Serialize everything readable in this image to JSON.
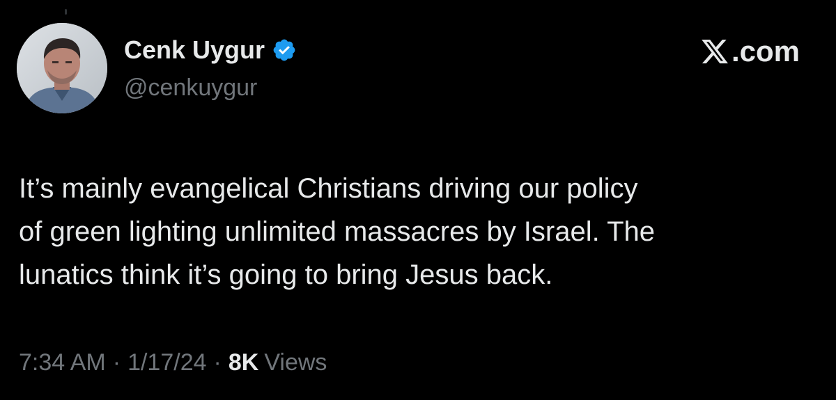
{
  "author": {
    "display_name": "Cenk Uygur",
    "handle": "@cenkuygur",
    "verified": true,
    "verified_icon": "verified-badge-icon",
    "verified_color": "#1d9bf0"
  },
  "brand": {
    "logo_icon": "x-logo-icon",
    "text": ".com"
  },
  "tweet": {
    "lines": [
      "It’s mainly evangelical Christians driving our policy",
      "of green lighting unlimited massacres by Israel. The",
      "lunatics think it’s going to bring Jesus back."
    ]
  },
  "meta": {
    "time": "7:34 AM",
    "separator": "·",
    "date": "1/17/24",
    "views_count": "8K",
    "views_label": "Views"
  },
  "colors": {
    "background": "#000000",
    "primary_text": "#e7e9ea",
    "secondary_text": "#71767b"
  }
}
